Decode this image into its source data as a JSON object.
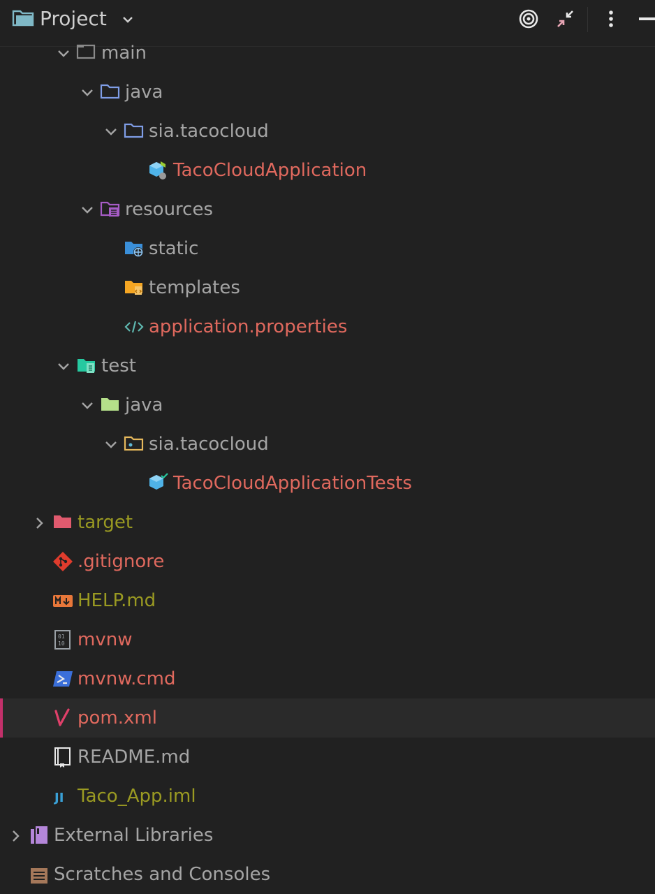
{
  "header": {
    "title": "Project",
    "icons": [
      "project-folder-icon",
      "chevron-down-icon",
      "locate-target-icon",
      "collapse-all-icon",
      "more-vertical-icon",
      "minimize-icon"
    ]
  },
  "colors": {
    "background": "#212121",
    "modified_file": "#e0695e",
    "ignored_file": "#9a9a22",
    "normal_text": "#a5a5a5",
    "selection_accent": "#c3306a"
  },
  "tree": [
    {
      "id": "main",
      "label": "main",
      "icon": "module-folder-icon",
      "expanded": true,
      "color": "gray"
    },
    {
      "id": "main-java",
      "label": "java",
      "icon": "source-folder-icon",
      "expanded": true,
      "color": "gray"
    },
    {
      "id": "main-pkg",
      "label": "sia.tacocloud",
      "icon": "package-icon",
      "expanded": true,
      "color": "gray"
    },
    {
      "id": "app-class",
      "label": "TacoCloudApplication",
      "icon": "spring-boot-class-icon",
      "color": "red"
    },
    {
      "id": "resources",
      "label": "resources",
      "icon": "resources-folder-icon",
      "expanded": true,
      "color": "gray"
    },
    {
      "id": "static",
      "label": "static",
      "icon": "web-folder-icon",
      "color": "gray"
    },
    {
      "id": "templates",
      "label": "templates",
      "icon": "templates-folder-icon",
      "color": "gray"
    },
    {
      "id": "app-props",
      "label": "application.properties",
      "icon": "properties-file-icon",
      "color": "red"
    },
    {
      "id": "test",
      "label": "test",
      "icon": "test-module-folder-icon",
      "expanded": true,
      "color": "gray"
    },
    {
      "id": "test-java",
      "label": "java",
      "icon": "test-source-folder-icon",
      "expanded": true,
      "color": "gray"
    },
    {
      "id": "test-pkg",
      "label": "sia.tacocloud",
      "icon": "test-package-icon",
      "expanded": true,
      "color": "gray"
    },
    {
      "id": "test-class",
      "label": "TacoCloudApplicationTests",
      "icon": "test-class-icon",
      "color": "red"
    },
    {
      "id": "target",
      "label": "target",
      "icon": "excluded-folder-icon",
      "expanded": false,
      "color": "olive"
    },
    {
      "id": "gitignore",
      "label": ".gitignore",
      "icon": "git-icon",
      "color": "red"
    },
    {
      "id": "help",
      "label": "HELP.md",
      "icon": "markdown-icon",
      "color": "olive"
    },
    {
      "id": "mvnw",
      "label": "mvnw",
      "icon": "binary-file-icon",
      "color": "red"
    },
    {
      "id": "mvnwcmd",
      "label": "mvnw.cmd",
      "icon": "powershell-icon",
      "color": "red"
    },
    {
      "id": "pom",
      "label": "pom.xml",
      "icon": "maven-icon",
      "color": "red",
      "selected": true
    },
    {
      "id": "readme",
      "label": "README.md",
      "icon": "readme-book-icon",
      "color": "gray"
    },
    {
      "id": "iml",
      "label": "Taco_App.iml",
      "icon": "intellij-module-icon",
      "color": "olive"
    },
    {
      "id": "extlibs",
      "label": "External Libraries",
      "icon": "library-icon",
      "expanded": false,
      "color": "gray"
    },
    {
      "id": "scratches",
      "label": "Scratches and Consoles",
      "icon": "scratches-icon",
      "color": "gray"
    }
  ]
}
